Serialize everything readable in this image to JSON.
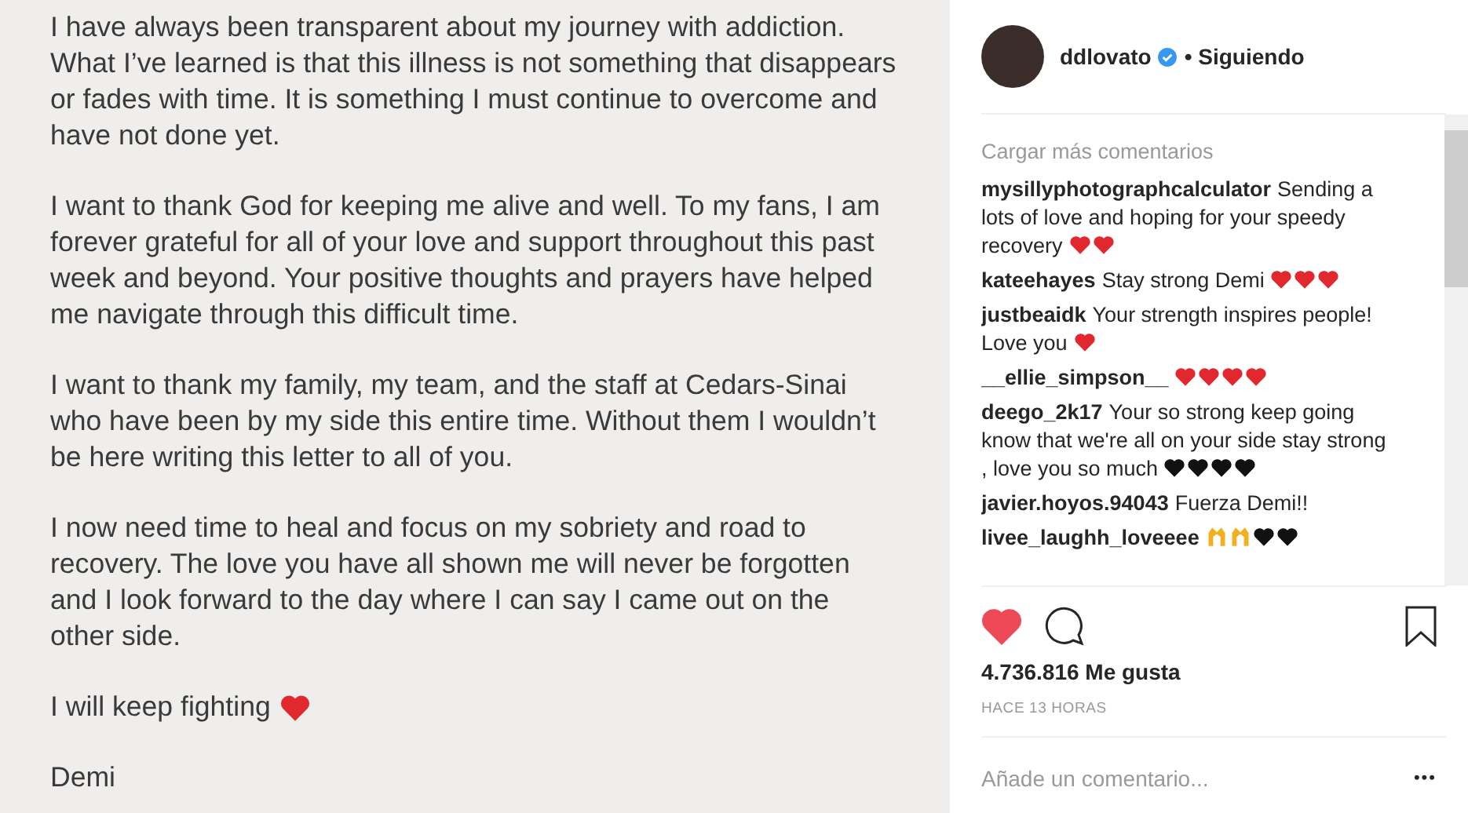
{
  "letter": {
    "paragraphs": [
      "I have always been transparent about my journey with addiction. What I’ve learned is that this illness is not something that disappears or fades with time.  It is something I must continue to overcome and have not done yet.",
      "I want to thank God for keeping me alive and well. To my fans, I am forever grateful for all of your love and support throughout this past week and beyond. Your positive thoughts and prayers have helped me navigate through this difficult time.",
      "I want to thank my family, my team, and the staff at Cedars-Sinai who have been by my side this entire time. Without them I wouldn’t be here writing this letter to all of you.",
      "I now need time to heal and focus on my sobriety and road to recovery. The love you have all shown me will never be forgotten and I look forward to the day where I can say I came out on the other side.",
      "I will keep fighting"
    ],
    "closing_emoji": [
      {
        "kind": "heart",
        "color": "#e0282e"
      }
    ],
    "signature": "Demi"
  },
  "post": {
    "username": "ddlovato",
    "verified": true,
    "follow_status": "• Siguiendo",
    "load_more": "Cargar más comentarios",
    "comments": [
      {
        "user": "mysillyphotographcalculator",
        "text": "Sending a lots of love and hoping for your speedy recovery",
        "emoji": [
          {
            "kind": "heart",
            "color": "#e0282e"
          },
          {
            "kind": "heart",
            "color": "#e0282e"
          }
        ]
      },
      {
        "user": "kateehayes",
        "text": "Stay strong Demi",
        "emoji": [
          {
            "kind": "heart",
            "color": "#e0282e"
          },
          {
            "kind": "heart",
            "color": "#e0282e"
          },
          {
            "kind": "heart",
            "color": "#e0282e"
          }
        ]
      },
      {
        "user": "justbeaidk",
        "text": "Your strength inspires people! Love you",
        "emoji": [
          {
            "kind": "heart",
            "color": "#e0282e"
          }
        ]
      },
      {
        "user": "__ellie_simpson__",
        "emoji": [
          {
            "kind": "heart",
            "color": "#e0282e"
          },
          {
            "kind": "heart",
            "color": "#e0282e"
          },
          {
            "kind": "heart",
            "color": "#e0282e"
          },
          {
            "kind": "heart",
            "color": "#e0282e"
          }
        ]
      },
      {
        "user": "deego_2k17",
        "text": "Your so strong keep going know that we're all on your side stay strong , love you so much",
        "emoji": [
          {
            "kind": "heart",
            "color": "#111111"
          },
          {
            "kind": "heart",
            "color": "#111111"
          },
          {
            "kind": "heart",
            "color": "#111111"
          },
          {
            "kind": "heart",
            "color": "#111111"
          }
        ]
      },
      {
        "user": "javier.hoyos.94043",
        "text": "Fuerza Demi!!"
      },
      {
        "user": "livee_laughh_loveeee",
        "emoji": [
          {
            "kind": "hands",
            "color": "#f2b01e"
          },
          {
            "kind": "hands",
            "color": "#f2b01e"
          },
          {
            "kind": "heart",
            "color": "#111111"
          },
          {
            "kind": "heart",
            "color": "#111111"
          }
        ]
      }
    ],
    "liked": true,
    "likes": "4.736.816 Me gusta",
    "time": "HACE 13 HORAS",
    "comment_placeholder": "Añade un comentario...",
    "more": "•••"
  }
}
